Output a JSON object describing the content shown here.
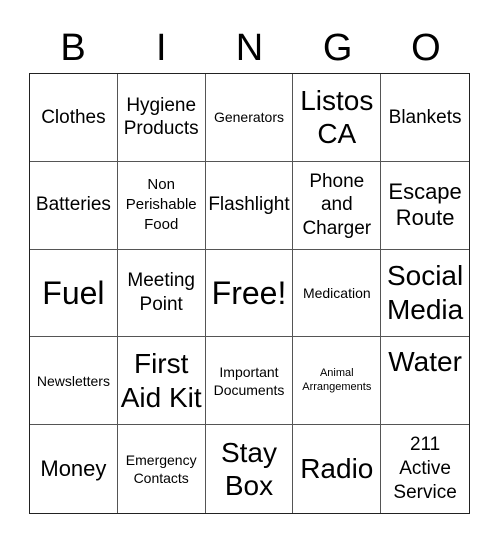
{
  "header": {
    "letters": [
      "B",
      "I",
      "N",
      "G",
      "O"
    ]
  },
  "cells": [
    {
      "text": "Clothes",
      "size": "s-lg"
    },
    {
      "text": "Hygiene Products",
      "size": "s-lg"
    },
    {
      "text": "Generators",
      "size": "s-sm"
    },
    {
      "text": "Listos CA",
      "size": "s-xxl"
    },
    {
      "text": "Blankets",
      "size": "s-lg"
    },
    {
      "text": "Batteries",
      "size": "s-lg"
    },
    {
      "text": "Non Perishable Food",
      "size": "s-md"
    },
    {
      "text": "Flashlight",
      "size": "s-lg"
    },
    {
      "text": "Phone and Charger",
      "size": "s-lg"
    },
    {
      "text": "Escape Route",
      "size": "s-xl"
    },
    {
      "text": "Fuel",
      "size": "s-huge"
    },
    {
      "text": "Meeting Point",
      "size": "s-lg"
    },
    {
      "text": "Free!",
      "size": "s-huge"
    },
    {
      "text": "Medication",
      "size": "s-sm"
    },
    {
      "text": "Social Media",
      "size": "s-xxl"
    },
    {
      "text": "Newsletters",
      "size": "s-sm"
    },
    {
      "text": "First Aid Kit",
      "size": "s-xxl"
    },
    {
      "text": "Important Documents",
      "size": "s-sm"
    },
    {
      "text": "Animal Arrangements",
      "size": "s-xs"
    },
    {
      "text": "Water",
      "size": "s-xxl",
      "align": "top"
    },
    {
      "text": "Money",
      "size": "s-xl"
    },
    {
      "text": "Emergency Contacts",
      "size": "s-sm"
    },
    {
      "text": "Stay Box",
      "size": "s-xxl"
    },
    {
      "text": "Radio",
      "size": "s-xxl"
    },
    {
      "text": "211 Active Service",
      "size": "s-lg"
    }
  ]
}
